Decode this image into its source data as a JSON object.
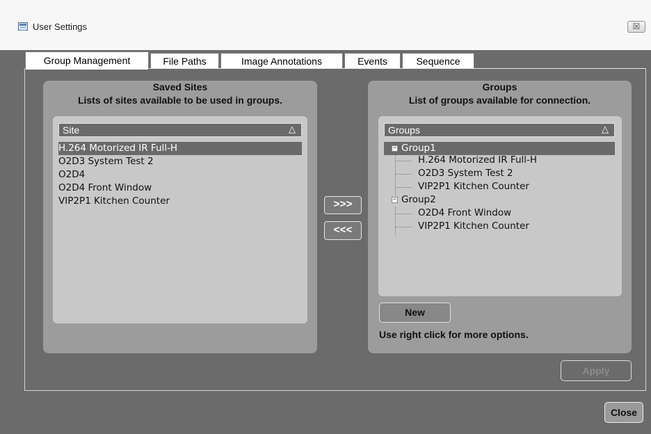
{
  "window": {
    "title": "User Settings",
    "close_glyph": "☒"
  },
  "tabs": [
    {
      "label": "Group Management",
      "active": true
    },
    {
      "label": "File Paths",
      "active": false
    },
    {
      "label": "Image Annotations",
      "active": false
    },
    {
      "label": "Events",
      "active": false
    },
    {
      "label": "Sequence",
      "active": false
    }
  ],
  "saved_sites": {
    "title": "Saved Sites",
    "subtitle": "Lists of sites available to be used in groups.",
    "column_header": "Site",
    "sort_icon": "△",
    "items": [
      "H.264 Motorized IR Full-H",
      "O2D3 System Test 2",
      "O2D4",
      "O2D4 Front Window",
      "VIP2P1 Kitchen Counter"
    ],
    "selected_index": 0
  },
  "transfer": {
    "add_label": ">>>",
    "remove_label": "<<<"
  },
  "groups": {
    "title": "Groups",
    "subtitle": "List of groups available for connection.",
    "column_header": "Groups",
    "sort_icon": "△",
    "tree": [
      {
        "name": "Group1",
        "expander": "−",
        "selected": true,
        "children": [
          "H.264 Motorized IR Full-H",
          "O2D3 System Test 2",
          "VIP2P1 Kitchen Counter"
        ]
      },
      {
        "name": "Group2",
        "expander": "−",
        "selected": false,
        "children": [
          "O2D4 Front Window",
          "VIP2P1 Kitchen Counter"
        ]
      }
    ],
    "new_button": "New",
    "hint": "Use right click for more options."
  },
  "footer": {
    "apply_label": "Apply",
    "close_label": "Close"
  },
  "colors": {
    "window_bg": "#6b6b6b",
    "panel_bg": "#9c9c9c",
    "list_bg": "#c8c8c8",
    "selection_bg": "#6a6a6a"
  }
}
